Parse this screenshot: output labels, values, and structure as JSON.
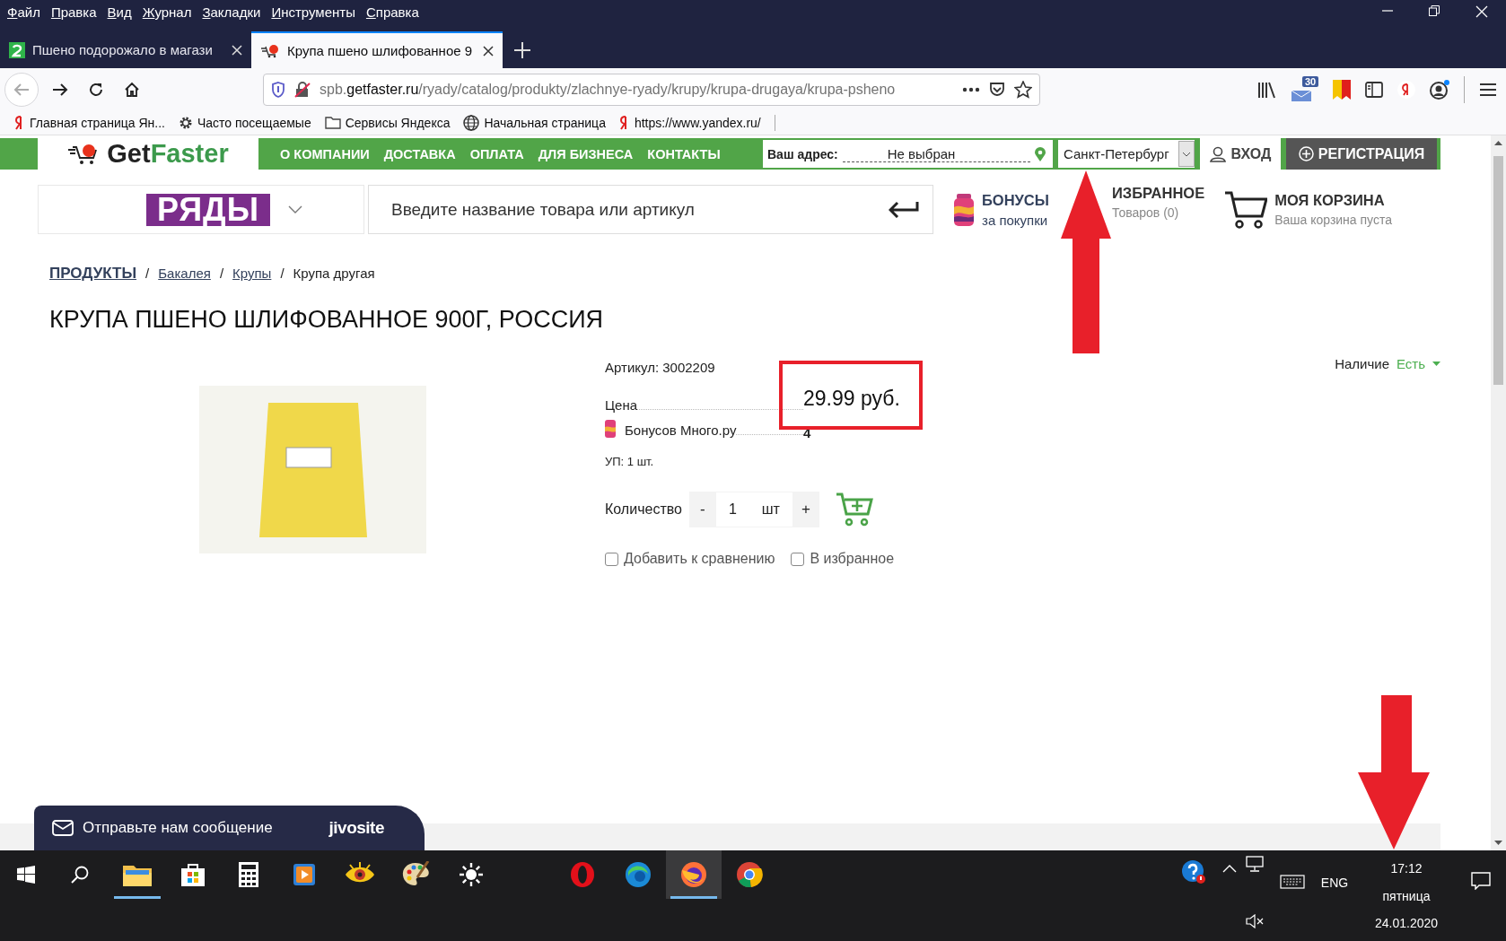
{
  "menu": [
    "Файл",
    "Правка",
    "Вид",
    "Журнал",
    "Закладки",
    "Инструменты",
    "Справка"
  ],
  "tabs": [
    {
      "title": "Пшено подорожало в магази",
      "selected": false
    },
    {
      "title": "Крупа пшено шлифованное 9",
      "selected": true
    }
  ],
  "address_bar": {
    "url_subdomain": "spb.",
    "url_domain": "getfaster.ru",
    "url_path": "/ryady/catalog/produkty/zlachnye-ryady/krupy/krupa-drugaya/krupa-psheno"
  },
  "toolbar": {
    "mail_badge": "30"
  },
  "bookmarks": [
    {
      "label": "Главная страница Ян...",
      "kind": "yandex"
    },
    {
      "label": "Часто посещаемые",
      "kind": "gear"
    },
    {
      "label": "Сервисы Яндекса",
      "kind": "folder"
    },
    {
      "label": "Начальная страница",
      "kind": "globe"
    },
    {
      "label": "https://www.yandex.ru/",
      "kind": "yandex"
    }
  ],
  "site": {
    "logo": {
      "first": "Get",
      "second": "Faster"
    },
    "nav": [
      "О КОМПАНИИ",
      "ДОСТАВКА",
      "ОПЛАТА",
      "ДЛЯ БИЗНЕСА",
      "КОНТАКТЫ"
    ],
    "address": {
      "label": "Ваш адрес:",
      "value": "Не выбран"
    },
    "city": "Санкт-Петербург",
    "login": "ВХОД",
    "register": "РЕГИСТРАЦИЯ",
    "store_logo": "РЯДЫ",
    "search": {
      "placeholder": "Введите название товара или артикул"
    },
    "bonuses": {
      "title": "БОНУСЫ",
      "subtitle": "за покупки"
    },
    "favorites": {
      "title": "ИЗБРАННОЕ",
      "subtitle": "Товаров (0)"
    },
    "cart": {
      "title": "МОЯ КОРЗИНА",
      "subtitle": "Ваша корзина пуста"
    }
  },
  "breadcrumbs": [
    {
      "label": "ПРОДУКТЫ",
      "kind": "root"
    },
    {
      "separator": "/",
      "label": "Бакалея",
      "kind": "link"
    },
    {
      "separator": "/",
      "label": "Крупы",
      "kind": "link"
    },
    {
      "separator": "/",
      "label": "Крупа другая",
      "kind": "current"
    }
  ],
  "product": {
    "title": "КРУПА ПШЕНО ШЛИФОВАННОЕ 900Г, РОССИЯ",
    "sku": "Артикул: 3002209",
    "availability": {
      "label": "Наличие",
      "value": "Есть"
    },
    "price": {
      "label": "Цена",
      "value": "29.99 руб."
    },
    "bonus": {
      "label": "Бонусов Много.ру",
      "value": "4"
    },
    "pack": "УП: 1 шт.",
    "quantity": {
      "label": "Количество",
      "minus": "-",
      "value": "1",
      "unit": "шт",
      "plus": "+"
    },
    "options": [
      {
        "label": "Добавить к сравнению",
        "checked": false
      },
      {
        "label": "В избранное",
        "checked": false
      }
    ]
  },
  "chat_widget": {
    "text": "Отправьте нам сообщение",
    "brand": "jivosite"
  },
  "annotations": {
    "arrow_to_city": true,
    "arrow_to_clock": true,
    "frame_on_price": true
  },
  "taskbar": {
    "apps": [
      {
        "kind": "explorer",
        "running": true,
        "active": false
      },
      {
        "kind": "store",
        "running": false,
        "active": false
      },
      {
        "kind": "calculator",
        "running": false,
        "active": false
      },
      {
        "kind": "player",
        "running": false,
        "active": false
      },
      {
        "kind": "eye",
        "running": false,
        "active": false
      },
      {
        "kind": "palette",
        "running": false,
        "active": false
      },
      {
        "kind": "sun",
        "running": false,
        "active": false
      },
      {
        "kind": "opera",
        "running": false,
        "active": false
      },
      {
        "kind": "edge",
        "running": false,
        "active": false
      },
      {
        "kind": "firefox",
        "running": true,
        "active": true
      },
      {
        "kind": "chrome",
        "running": false,
        "active": false
      }
    ],
    "tray": {
      "language": "ENG",
      "time": "17:12",
      "weekday": "пятница",
      "date": "24.01.2020"
    }
  }
}
